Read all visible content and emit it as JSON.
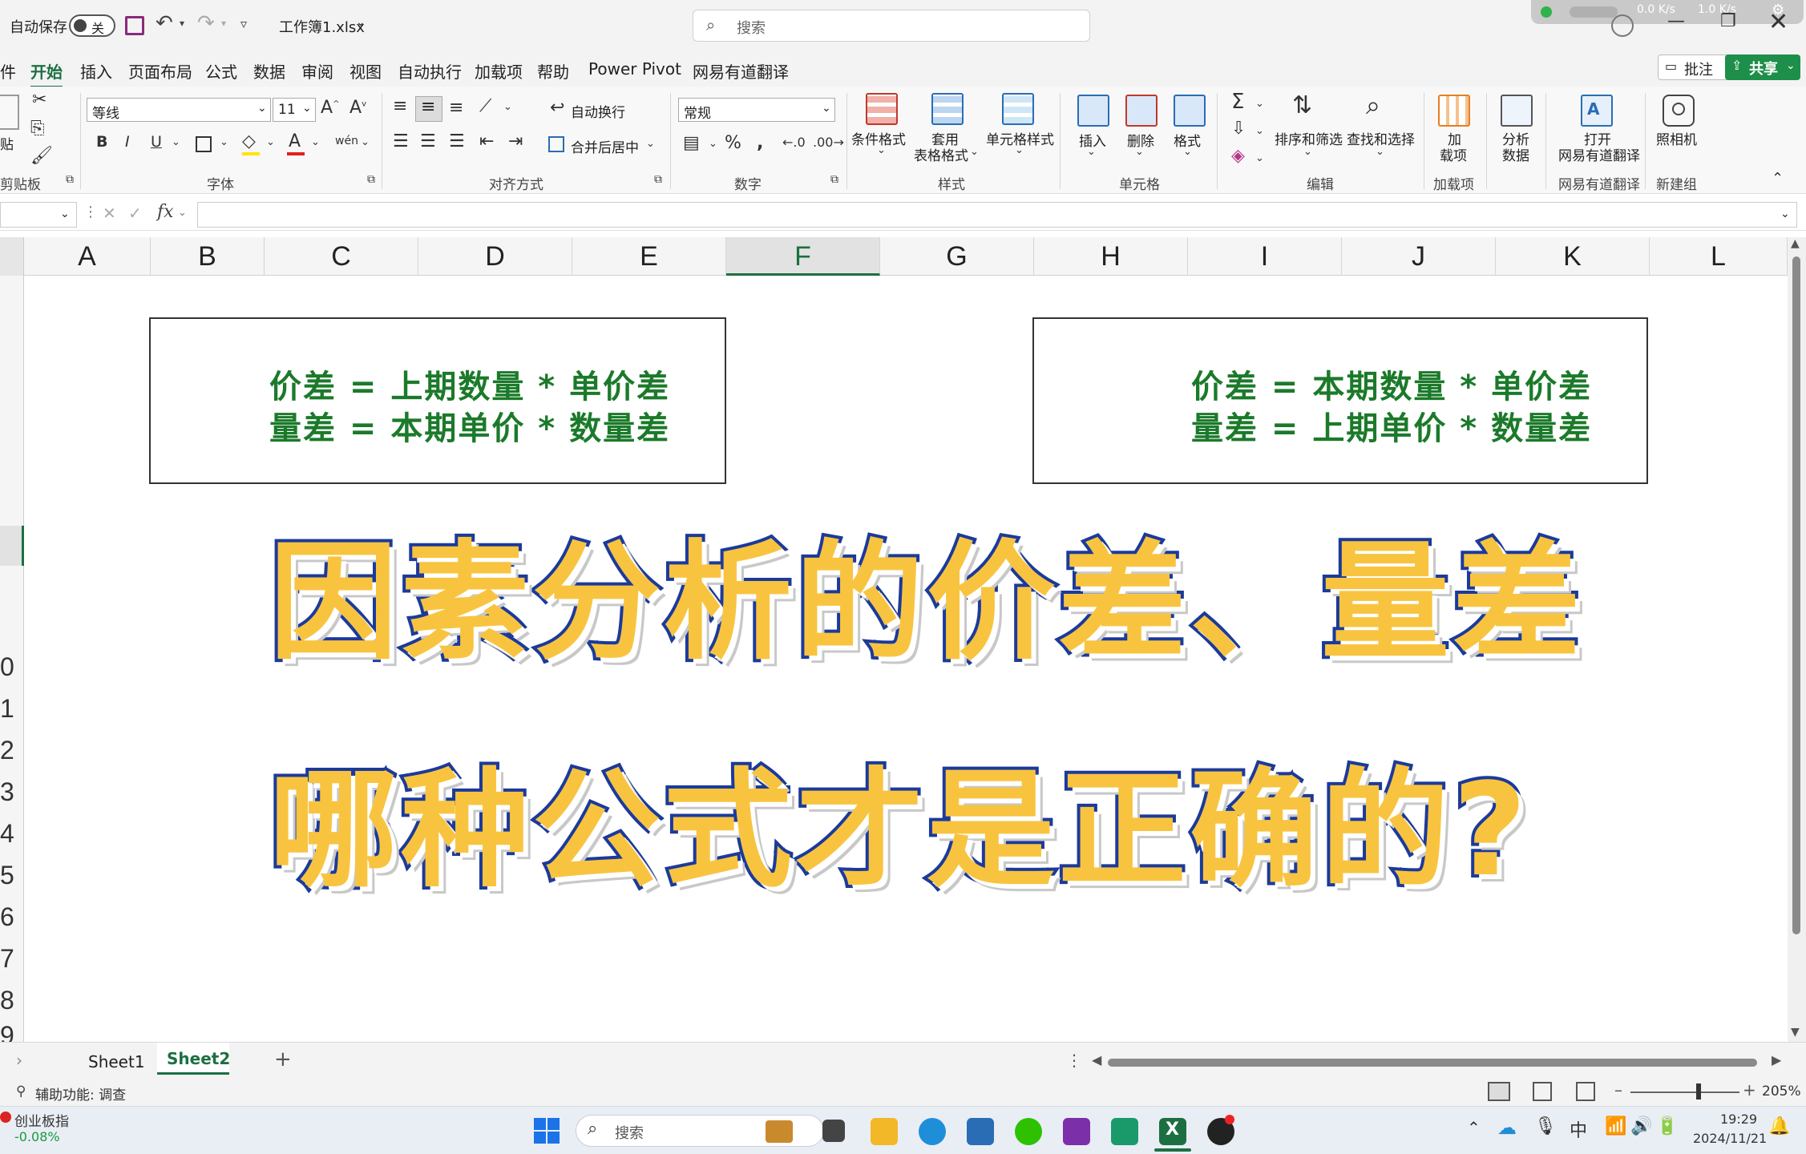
{
  "titlebar": {
    "autosave_label": "自动保存",
    "autosave_state": "关",
    "filename": "工作簿1.xlsx",
    "search_placeholder": "搜索",
    "net_up": "0.0 K/s",
    "net_down": "1.0 K/s"
  },
  "menu": {
    "items": [
      "件",
      "开始",
      "插入",
      "页面布局",
      "公式",
      "数据",
      "审阅",
      "视图",
      "自动执行",
      "加载项",
      "帮助",
      "Power Pivot",
      "网易有道翻译"
    ],
    "comments_label": "批注",
    "share_label": "共享"
  },
  "ribbon": {
    "font_name": "等线",
    "font_size": "11",
    "wrap_text": "自动换行",
    "merge_center": "合并后居中",
    "number_format": "常规",
    "conditional_format": "条件格式",
    "table_format": [
      "套用",
      "表格格式"
    ],
    "cell_style": "单元格样式",
    "insert": "插入",
    "delete": "删除",
    "format": "格式",
    "sort_filter": "排序和筛选",
    "find_select": "查找和选择",
    "addins": [
      "加",
      "载项"
    ],
    "analyze": [
      "分析",
      "数据"
    ],
    "open_youdao": [
      "打开",
      "网易有道翻译"
    ],
    "camera": "照相机",
    "groups": {
      "clipboard": "剪贴板",
      "font": "字体",
      "alignment": "对齐方式",
      "number": "数字",
      "styles": "样式",
      "cells": "单元格",
      "editing": "编辑",
      "addins": "加载项",
      "youdao": "网易有道翻译",
      "newgroup": "新建组"
    },
    "paste_label": "贴"
  },
  "columns": [
    "A",
    "B",
    "C",
    "D",
    "E",
    "F",
    "G",
    "H",
    "I",
    "J",
    "K",
    "L"
  ],
  "selected_column": "F",
  "rows_visible": [
    "0",
    "1",
    "2",
    "3",
    "4",
    "5",
    "6",
    "7",
    "8",
    "9"
  ],
  "content": {
    "box1": [
      "价差 = 上期数量 * 单价差",
      "量差 = 本期单价 * 数量差"
    ],
    "box2": [
      "价差 = 本期数量 * 单价差",
      "量差 = 上期单价 * 数量差"
    ],
    "title_line1": "因素分析的价差、量差",
    "title_line2": "哪种公式才是正确的?"
  },
  "sheets": [
    "Sheet1",
    "Sheet2"
  ],
  "active_sheet": "Sheet2",
  "status": {
    "accessibility": "辅助功能: 调查",
    "zoom": "205%"
  },
  "taskbar": {
    "stock_name": "创业板指",
    "stock_change": "-0.08%",
    "search_label": "搜索",
    "ime": "中",
    "time": "19:29",
    "date": "2024/11/21"
  },
  "colors": {
    "excel_green": "#1d6f42",
    "formula_green": "#1b7a2a",
    "title_yellow": "#f8c440",
    "title_outline": "#1b3a9b"
  }
}
